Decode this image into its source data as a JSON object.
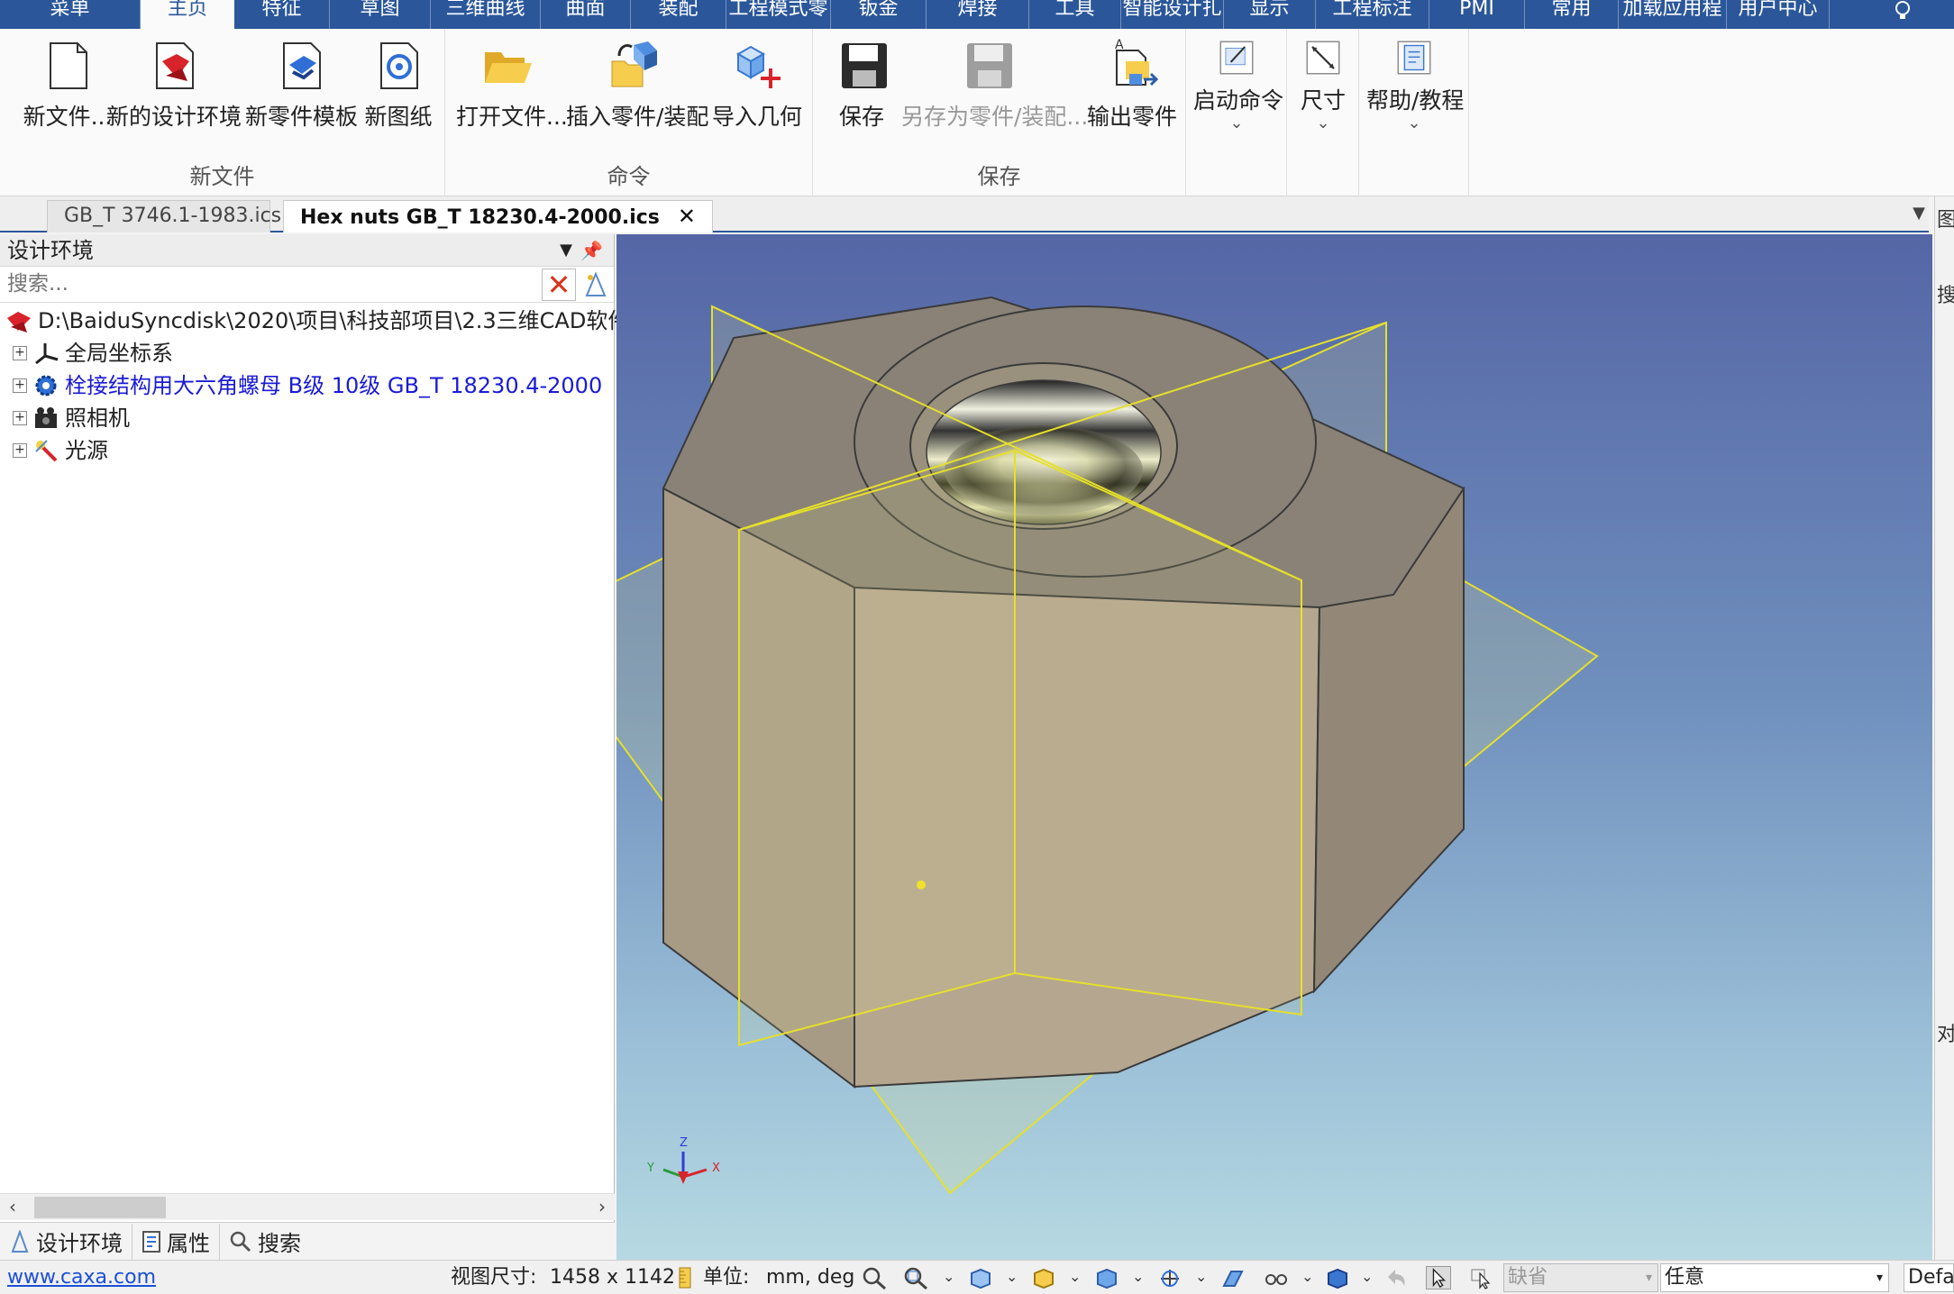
{
  "ribbon_tabs": [
    {
      "label": "菜单",
      "width": 156
    },
    {
      "label": "主页",
      "width": 104,
      "active": true
    },
    {
      "label": "特征",
      "width": 106
    },
    {
      "label": "草图",
      "width": 112
    },
    {
      "label": "三维曲线",
      "width": 122
    },
    {
      "label": "曲面",
      "width": 100
    },
    {
      "label": "装配",
      "width": 106
    },
    {
      "label": "工程模式零",
      "width": 116
    },
    {
      "label": "钣金",
      "width": 106
    },
    {
      "label": "焊接",
      "width": 114
    },
    {
      "label": "工具",
      "width": 102
    },
    {
      "label": "智能设计扎",
      "width": 114
    },
    {
      "label": "显示",
      "width": 102
    },
    {
      "label": "工程标注",
      "width": 126
    },
    {
      "label": "PMI",
      "width": 106
    },
    {
      "label": "常用",
      "width": 104
    },
    {
      "label": "加载应用程",
      "width": 120
    },
    {
      "label": "用户中心",
      "width": 114
    }
  ],
  "ribbon_groups": {
    "new_file": {
      "label": "新文件",
      "buttons": [
        "新文件...",
        "新的设计环境",
        "新零件模板",
        "新图纸"
      ]
    },
    "command": {
      "label": "命令",
      "buttons": [
        "打开文件...",
        "插入零件/装配",
        "导入几何"
      ]
    },
    "save": {
      "label": "保存",
      "buttons": [
        "保存",
        "另存为零件/装配...",
        "输出零件"
      ]
    },
    "extra": {
      "start_command": "启动命令",
      "dimension": "尺寸",
      "help": "帮助/教程"
    }
  },
  "doc_tabs": {
    "inactive": "GB_T 3746.1-1983.ics",
    "active": "Hex nuts GB_T 18230.4-2000.ics",
    "close": "✕"
  },
  "left_panel": {
    "title": "设计环境",
    "search_placeholder": "搜索...",
    "tree": {
      "root": "D:\\BaiduSyncdisk\\2020\\项目\\科技部项目\\2.3三维CAD软件",
      "items": [
        "全局坐标系",
        "栓接结构用大六角螺母 B级 10级 GB_T 18230.4-2000",
        "照相机",
        "光源"
      ]
    },
    "bottom_tabs": [
      "设计环境",
      "属性",
      "搜索"
    ]
  },
  "right_strip": [
    "图",
    "搜",
    "对"
  ],
  "status_bar": {
    "website": "www.caxa.com",
    "view_size_label": "视图尺寸:",
    "view_size_value": "1458 x 1142",
    "unit_label": "单位:",
    "unit_value": "mm, deg",
    "default_box": "缺省",
    "any_box": "任意",
    "right_box": "Defa"
  },
  "axis_labels": {
    "z": "Z",
    "x": "X",
    "y": "Y"
  },
  "colors": {
    "ribbon_blue": "#2b579a",
    "nut_side": "#b5a690",
    "nut_top": "#8a8277",
    "plane_yellow": "#e6e02a"
  }
}
